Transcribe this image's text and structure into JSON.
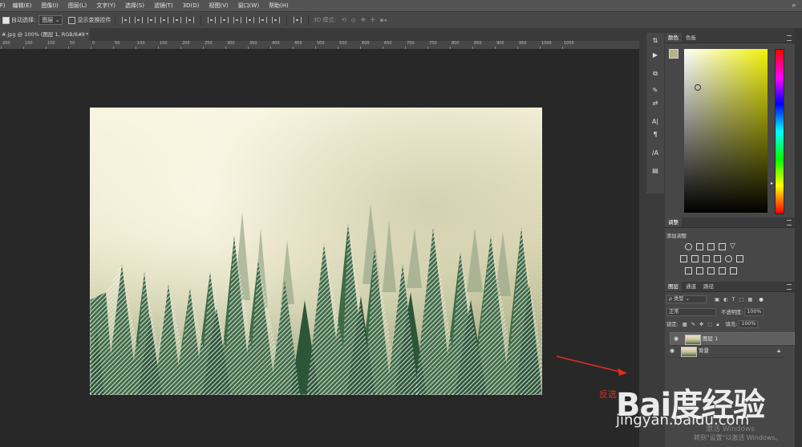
{
  "menu": {
    "items": [
      "编辑(E)",
      "图像(I)",
      "图层(L)",
      "文字(Y)",
      "选择(S)",
      "滤镜(T)",
      "3D(D)",
      "视图(V)",
      "窗口(W)",
      "帮助(H)"
    ],
    "edge_label": "(F)"
  },
  "options": {
    "auto_select_label": "自动选择:",
    "auto_select_value": "图层",
    "show_transform_label": "显示变换控件",
    "mode_3d_label": "3D 模式:"
  },
  "document": {
    "tab_title": "#.jpg @ 100% (图层 1, RGB/8#) *",
    "close_glyph": "×"
  },
  "ruler": {
    "labels": [
      "200",
      "150",
      "100",
      "50",
      "0",
      "50",
      "100",
      "150",
      "200",
      "250",
      "300",
      "350",
      "400",
      "450",
      "500",
      "550",
      "600",
      "650",
      "700",
      "750",
      "800",
      "850",
      "900",
      "950",
      "1000",
      "1050"
    ]
  },
  "panels": {
    "color": {
      "tabs": [
        "颜色",
        "色板"
      ],
      "fg_color": "#b6b28a",
      "bg_color": "#d5d3bd"
    },
    "adjustments": {
      "tab": "调整",
      "add_label": "添加调整"
    },
    "layers": {
      "tabs": [
        "图层",
        "通道",
        "路径"
      ],
      "kind_label": "ρ 类型",
      "blend_mode": "正常",
      "opacity_label": "不透明度:",
      "opacity_value": "100%",
      "lock_label": "锁定:",
      "fill_label": "填充:",
      "fill_value": "100%",
      "items": [
        {
          "name": "图层 1",
          "selected": true,
          "locked": false
        },
        {
          "name": "背景",
          "selected": false,
          "locked": true
        }
      ]
    }
  },
  "annotation": {
    "text": "反选",
    "color": "#e03020"
  },
  "watermark": {
    "logo": "Bai度经验",
    "url": "jingyan.baidu.com",
    "activate_line1": "激活 Windows",
    "activate_line2": "转到\"设置\"以激活 Windows。"
  }
}
